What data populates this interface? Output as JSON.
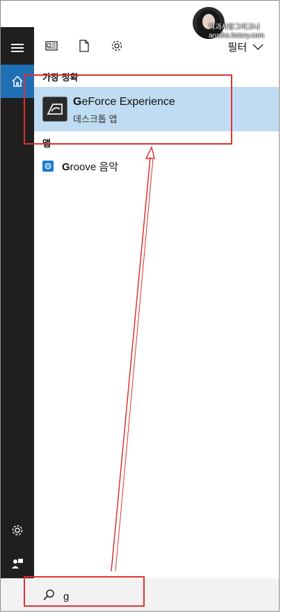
{
  "toolbar": {
    "filter_label": "필터",
    "icons": [
      "news-icon",
      "document-icon",
      "settings-icon",
      "chevron-down-icon"
    ]
  },
  "sections": {
    "best_match": "가장 정확",
    "apps": "앱"
  },
  "best_match": {
    "title_bold": "G",
    "title_rest": "eForce Experience",
    "subtitle": "데스크톱 앱"
  },
  "apps": [
    {
      "title_bold": "G",
      "title_rest": "roove 음악"
    }
  ],
  "search": {
    "query": "g"
  },
  "watermark": {
    "line1": "떡과사랑그리고나",
    "line2": "ansths.tistory.com"
  },
  "colors": {
    "sidebar": "#1f1f1f",
    "accent": "#1f6fb5",
    "best_match_bg": "#bfdcf2",
    "annotation": "#e03030"
  }
}
